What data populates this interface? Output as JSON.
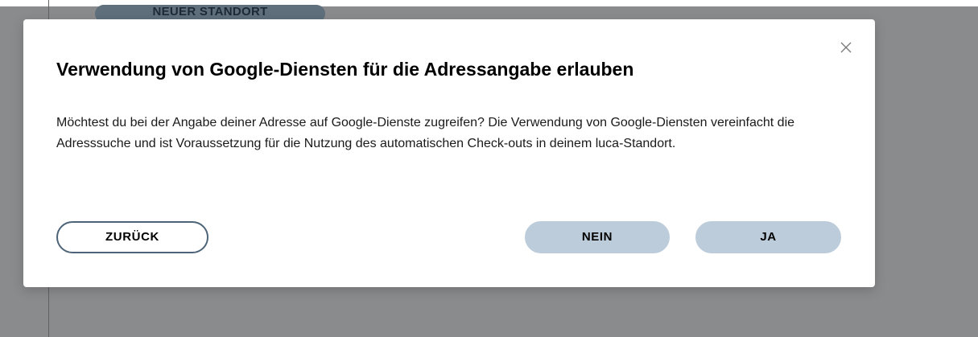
{
  "background": {
    "pill_label": "NEUER STANDORT"
  },
  "dialog": {
    "title": "Verwendung von Google-Diensten für die Adressangabe erlauben",
    "body": "Möchtest du bei der Angabe deiner Adresse auf Google-Dienste zugreifen? Die Verwendung von Google-Diensten vereinfacht die Adresssuche und ist Voraussetzung für die Nutzung des automatischen Check-outs in deinem luca-Standort.",
    "close_icon": "close-icon",
    "buttons": {
      "back_label": "ZURÜCK",
      "no_label": "NEIN",
      "yes_label": "JA"
    }
  },
  "colors": {
    "overlay": "#8a8b8d",
    "dialog_background": "#ffffff",
    "secondary_button_border": "#4d6478",
    "primary_button_fill": "#bcccda",
    "text": "#000000"
  }
}
